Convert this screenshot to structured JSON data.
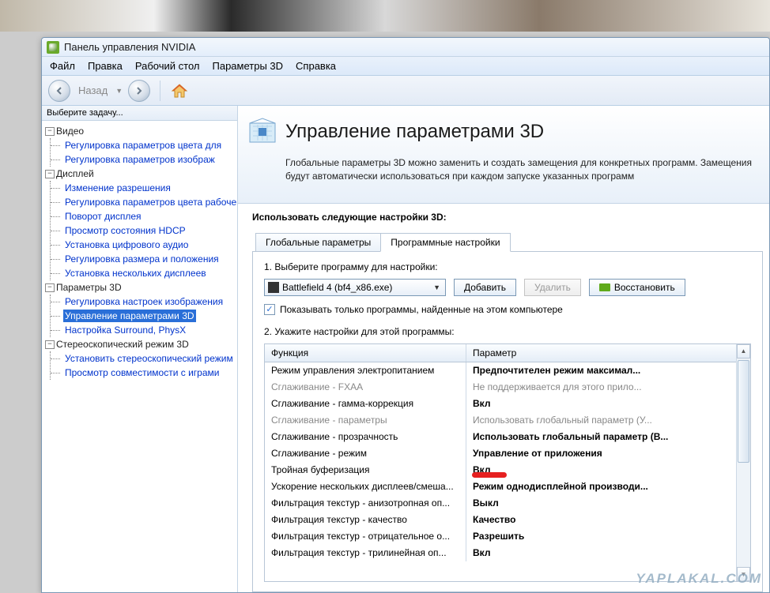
{
  "window": {
    "title": "Панель управления NVIDIA"
  },
  "menu": {
    "file": "Файл",
    "edit": "Правка",
    "desktop": "Рабочий стол",
    "params3d": "Параметры 3D",
    "help": "Справка"
  },
  "toolbar": {
    "back": "Назад"
  },
  "sidebar": {
    "header": "Выберите задачу...",
    "video": "Видео",
    "video_items": [
      "Регулировка параметров цвета для",
      "Регулировка параметров изображ"
    ],
    "display": "Дисплей",
    "display_items": [
      "Изменение разрешения",
      "Регулировка параметров цвета рабочего",
      "Поворот дисплея",
      "Просмотр состояния HDCP",
      "Установка цифрового аудио",
      "Регулировка размера и положения",
      "Установка нескольких дисплеев"
    ],
    "p3d": "Параметры 3D",
    "p3d_items": [
      "Регулировка настроек изображения",
      "Управление параметрами 3D",
      "Настройка Surround, PhysX"
    ],
    "stereo": "Стереоскопический режим 3D",
    "stereo_items": [
      "Установить стереоскопический режим",
      "Просмотр совместимости с играми"
    ]
  },
  "page": {
    "title": "Управление параметрами 3D",
    "desc": "Глобальные параметры 3D можно заменить и создать замещения для конкретных программ. Замещения будут автоматически использоваться при каждом запуске указанных программ"
  },
  "section_heading": "Использовать следующие настройки 3D:",
  "tabs": {
    "global": "Глобальные параметры",
    "program": "Программные настройки"
  },
  "step1": "1. Выберите программу для настройки:",
  "program_select": "Battlefield 4 (bf4_x86.exe)",
  "buttons": {
    "add": "Добавить",
    "remove": "Удалить",
    "restore": "Восстановить"
  },
  "checkbox_label": "Показывать только программы, найденные на этом компьютере",
  "step2": "2. Укажите настройки для этой программы:",
  "grid": {
    "col1": "Функция",
    "col2": "Параметр",
    "rows": [
      {
        "f": "Режим управления электропитанием",
        "p": "Предпочтителен режим максимал...",
        "d": false
      },
      {
        "f": "Сглаживание - FXAA",
        "p": "Не поддерживается для этого прило...",
        "d": true
      },
      {
        "f": "Сглаживание - гамма-коррекция",
        "p": "Вкл",
        "d": false
      },
      {
        "f": "Сглаживание - параметры",
        "p": "Использовать глобальный параметр (У...",
        "d": true
      },
      {
        "f": "Сглаживание - прозрачность",
        "p": "Использовать глобальный параметр (В...",
        "d": false
      },
      {
        "f": "Сглаживание - режим",
        "p": "Управление от приложения",
        "d": false
      },
      {
        "f": "Тройная буферизация",
        "p": "Вкл",
        "d": false
      },
      {
        "f": "Ускорение нескольких дисплеев/смеша...",
        "p": "Режим однодисплейной производи...",
        "d": false
      },
      {
        "f": "Фильтрация текстур - анизотропная оп...",
        "p": "Выкл",
        "d": false
      },
      {
        "f": "Фильтрация текстур - качество",
        "p": "Качество",
        "d": false
      },
      {
        "f": "Фильтрация текстур - отрицательное о...",
        "p": "Разрешить",
        "d": false
      },
      {
        "f": "Фильтрация текстур - трилинейная оп...",
        "p": "Вкл",
        "d": false
      }
    ]
  },
  "watermark": "YAPLAKAL.COM"
}
